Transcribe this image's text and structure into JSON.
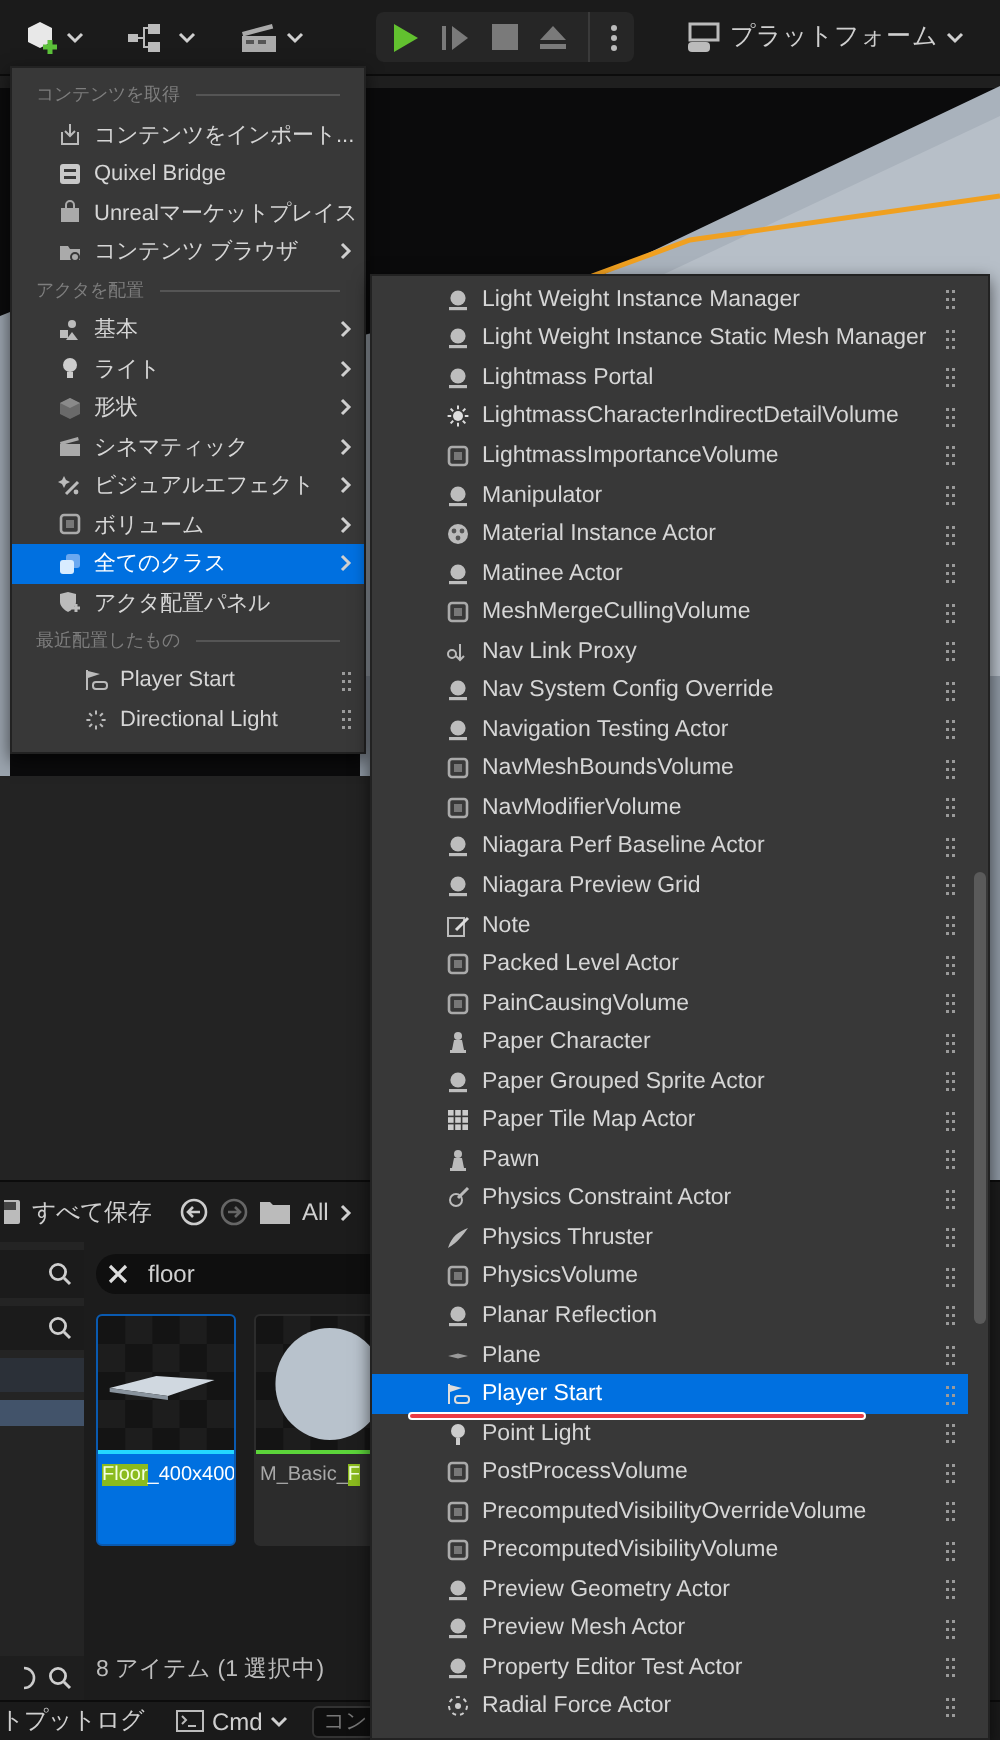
{
  "toolbar": {
    "platform_label": "プラットフォーム"
  },
  "content_browser": {
    "save_all": "すべて保存",
    "path": "All",
    "search": {
      "value": "floor"
    },
    "assets": [
      {
        "parts": [
          {
            "text": "Floor",
            "match": true
          },
          {
            "text": "_400x400",
            "match": false
          }
        ],
        "kind": "slab",
        "selected": true
      },
      {
        "parts": [
          {
            "text": "M_Basic_",
            "match": false
          },
          {
            "text": "F",
            "match": true
          }
        ],
        "kind": "sphere",
        "selected": false
      }
    ],
    "status": "8 アイテム (1 選択中)"
  },
  "bottom_bar": {
    "output_log_tab": "トプットログ",
    "cmd": "Cmd",
    "console_placeholder": "コン"
  },
  "place_menu": {
    "sections": [
      {
        "header": "コンテンツを取得",
        "items": [
          {
            "label": "コンテンツをインポート...",
            "kind": "import",
            "submenu": false,
            "selected": false
          },
          {
            "label": "Quixel Bridge",
            "kind": "bridge",
            "submenu": false,
            "selected": false
          },
          {
            "label": "Unrealマーケットプレイス",
            "kind": "market",
            "submenu": false,
            "selected": false
          },
          {
            "label": "コンテンツ ブラウザ",
            "kind": "browser",
            "submenu": true,
            "selected": false
          }
        ]
      },
      {
        "header": "アクタを配置",
        "items": [
          {
            "label": "基本",
            "kind": "basic",
            "submenu": true,
            "selected": false
          },
          {
            "label": "ライト",
            "kind": "light",
            "submenu": true,
            "selected": false
          },
          {
            "label": "形状",
            "kind": "shape",
            "submenu": true,
            "selected": false
          },
          {
            "label": "シネマティック",
            "kind": "cinematic",
            "submenu": true,
            "selected": false
          },
          {
            "label": "ビジュアルエフェクト",
            "kind": "vfx",
            "submenu": true,
            "selected": false
          },
          {
            "label": "ボリューム",
            "kind": "volume",
            "submenu": true,
            "selected": false
          },
          {
            "label": "全てのクラス",
            "kind": "classes",
            "submenu": true,
            "selected": true
          },
          {
            "label": "アクタ配置パネル",
            "kind": "panel",
            "submenu": false,
            "selected": false
          }
        ]
      },
      {
        "header": "最近配置したもの",
        "items": [
          {
            "label": "Player Start",
            "kind": "recent-flag",
            "submenu": false,
            "selected": false
          },
          {
            "label": "Directional Light",
            "kind": "recent-sun",
            "submenu": false,
            "selected": false
          }
        ]
      }
    ]
  },
  "all_classes_menu": {
    "items": [
      {
        "label": "Light Weight Instance Manager",
        "kind": "actor",
        "selected": false,
        "underlined": false
      },
      {
        "label": "Light Weight Instance Static Mesh Manager",
        "kind": "actor",
        "selected": false,
        "underlined": false
      },
      {
        "label": "Lightmass Portal",
        "kind": "actor",
        "selected": false,
        "underlined": false
      },
      {
        "label": "LightmassCharacterIndirectDetailVolume",
        "kind": "sun",
        "selected": false,
        "underlined": false
      },
      {
        "label": "LightmassImportanceVolume",
        "kind": "volume",
        "selected": false,
        "underlined": false
      },
      {
        "label": "Manipulator",
        "kind": "actor",
        "selected": false,
        "underlined": false
      },
      {
        "label": "Material Instance Actor",
        "kind": "material",
        "selected": false,
        "underlined": false
      },
      {
        "label": "Matinee Actor",
        "kind": "actor",
        "selected": false,
        "underlined": false
      },
      {
        "label": "MeshMergeCullingVolume",
        "kind": "volume",
        "selected": false,
        "underlined": false
      },
      {
        "label": "Nav Link Proxy",
        "kind": "navlink",
        "selected": false,
        "underlined": false
      },
      {
        "label": "Nav System Config Override",
        "kind": "actor",
        "selected": false,
        "underlined": false
      },
      {
        "label": "Navigation Testing Actor",
        "kind": "actor",
        "selected": false,
        "underlined": false
      },
      {
        "label": "NavMeshBoundsVolume",
        "kind": "volume",
        "selected": false,
        "underlined": false
      },
      {
        "label": "NavModifierVolume",
        "kind": "volume",
        "selected": false,
        "underlined": false
      },
      {
        "label": "Niagara Perf Baseline Actor",
        "kind": "actor",
        "selected": false,
        "underlined": false
      },
      {
        "label": "Niagara Preview Grid",
        "kind": "actor",
        "selected": false,
        "underlined": false
      },
      {
        "label": "Note",
        "kind": "note",
        "selected": false,
        "underlined": false
      },
      {
        "label": "Packed Level Actor",
        "kind": "volume",
        "selected": false,
        "underlined": false
      },
      {
        "label": "PainCausingVolume",
        "kind": "volume",
        "selected": false,
        "underlined": false
      },
      {
        "label": "Paper Character",
        "kind": "pawn",
        "selected": false,
        "underlined": false
      },
      {
        "label": "Paper Grouped Sprite Actor",
        "kind": "actor",
        "selected": false,
        "underlined": false
      },
      {
        "label": "Paper Tile Map Actor",
        "kind": "grid",
        "selected": false,
        "underlined": false
      },
      {
        "label": "Pawn",
        "kind": "pawn",
        "selected": false,
        "underlined": false
      },
      {
        "label": "Physics Constraint Actor",
        "kind": "constraint",
        "selected": false,
        "underlined": false
      },
      {
        "label": "Physics Thruster",
        "kind": "thruster",
        "selected": false,
        "underlined": false
      },
      {
        "label": "PhysicsVolume",
        "kind": "volume",
        "selected": false,
        "underlined": false
      },
      {
        "label": "Planar Reflection",
        "kind": "actor",
        "selected": false,
        "underlined": false
      },
      {
        "label": "Plane",
        "kind": "plane",
        "selected": false,
        "underlined": false
      },
      {
        "label": "Player Start",
        "kind": "flag",
        "selected": true,
        "underlined": true
      },
      {
        "label": "Point Light",
        "kind": "bulb",
        "selected": false,
        "underlined": false
      },
      {
        "label": "PostProcessVolume",
        "kind": "volume",
        "selected": false,
        "underlined": false
      },
      {
        "label": "PrecomputedVisibilityOverrideVolume",
        "kind": "volume",
        "selected": false,
        "underlined": false
      },
      {
        "label": "PrecomputedVisibilityVolume",
        "kind": "volume",
        "selected": false,
        "underlined": false
      },
      {
        "label": "Preview Geometry Actor",
        "kind": "actor",
        "selected": false,
        "underlined": false
      },
      {
        "label": "Preview Mesh Actor",
        "kind": "actor",
        "selected": false,
        "underlined": false
      },
      {
        "label": "Property Editor Test Actor",
        "kind": "actor",
        "selected": false,
        "underlined": false
      },
      {
        "label": "Radial Force Actor",
        "kind": "radial",
        "selected": false,
        "underlined": false
      }
    ]
  }
}
